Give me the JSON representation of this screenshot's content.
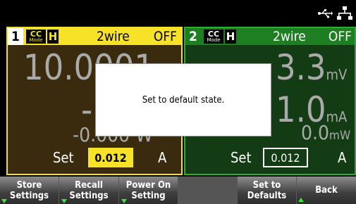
{
  "top_bar": {
    "icons": [
      "usb-icon",
      "lan-icon"
    ]
  },
  "channel1": {
    "number": "1",
    "mode_top": "CC",
    "mode_bottom": "Mode",
    "range": "H",
    "sense": "2wire",
    "output_state": "OFF",
    "voltage_reading": "10.0001",
    "current_reading": "-",
    "power_reading": "-0.000 W",
    "set_label": "Set",
    "set_value": "0.012",
    "set_unit": "A",
    "colors": {
      "accent": "#f7e227",
      "background": "#3a2a0e"
    }
  },
  "channel2": {
    "number": "2",
    "mode_top": "CC",
    "mode_bottom": "Mode",
    "range": "H",
    "sense": "2wire",
    "output_state": "OFF",
    "voltage_value": "3.3",
    "voltage_unit": "mV",
    "current_value": "1.0",
    "current_unit": "mA",
    "power_value": "0.0",
    "power_unit": "mW",
    "set_label": "Set",
    "set_value": "0.012",
    "set_unit": "A",
    "colors": {
      "accent": "#1e7e22",
      "background": "#133b14"
    }
  },
  "softkeys": [
    {
      "line1": "Store",
      "line2": "Settings"
    },
    {
      "line1": "Recall",
      "line2": "Settings"
    },
    {
      "line1": "Power On",
      "line2": "Setting"
    },
    {
      "line1": "",
      "line2": ""
    },
    {
      "line1": "Set to",
      "line2": "Defaults"
    },
    {
      "line1": "Back",
      "line2": ""
    }
  ],
  "dialog": {
    "message": "Set to default state."
  }
}
